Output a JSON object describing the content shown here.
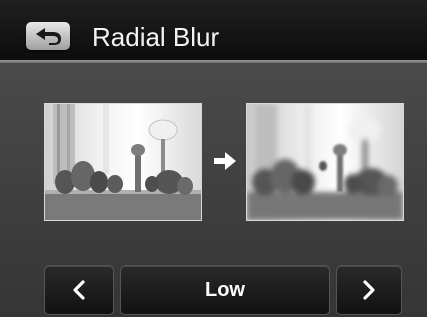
{
  "header": {
    "title": "Radial Blur",
    "back_icon": "return-arrow-icon"
  },
  "preview": {
    "original_thumbnail": "original-photo",
    "arrow_icon": "right-arrow-icon",
    "result_thumbnail": "radial-blur-photo"
  },
  "selector": {
    "prev_icon": "chevron-left-icon",
    "value": "Low",
    "next_icon": "chevron-right-icon"
  }
}
